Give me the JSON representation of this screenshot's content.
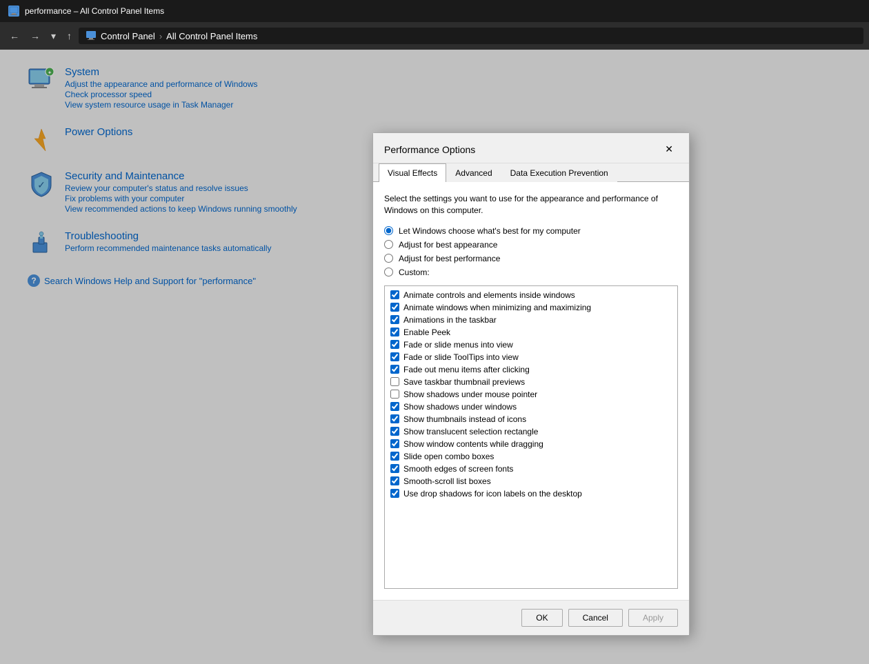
{
  "titleBar": {
    "title": "performance – All Control Panel Items",
    "icon": "monitor-icon"
  },
  "addressBar": {
    "backLabel": "←",
    "forwardLabel": "→",
    "downLabel": "▾",
    "upLabel": "↑",
    "path": [
      "Control Panel",
      "All Control Panel Items"
    ],
    "iconAlt": "control-panel-icon"
  },
  "controlPanel": {
    "items": [
      {
        "id": "system",
        "title": "System",
        "links": [
          "Adjust the appearance and performance of Windows",
          "Check processor speed",
          "View system resource usage in Task Manager"
        ]
      },
      {
        "id": "power",
        "title": "Power Options",
        "links": []
      },
      {
        "id": "security",
        "title": "Security and Maintenance",
        "links": [
          "Review your computer's status and resolve issues",
          "Fix problems with your computer",
          "View recommended actions to keep Windows running smoothly"
        ]
      },
      {
        "id": "troubleshoot",
        "title": "Troubleshooting",
        "links": [
          "Perform recommended maintenance tasks automatically"
        ]
      }
    ],
    "searchLink": "Search Windows Help and Support for \"performance\""
  },
  "dialog": {
    "title": "Performance Options",
    "closeLabel": "✕",
    "tabs": [
      {
        "id": "visual",
        "label": "Visual Effects",
        "active": true
      },
      {
        "id": "advanced",
        "label": "Advanced",
        "active": false
      },
      {
        "id": "dep",
        "label": "Data Execution Prevention",
        "active": false
      }
    ],
    "description": "Select the settings you want to use for the appearance and performance of Windows on this computer.",
    "radioOptions": [
      {
        "id": "r1",
        "label": "Let Windows choose what's best for my computer",
        "checked": true
      },
      {
        "id": "r2",
        "label": "Adjust for best appearance",
        "checked": false
      },
      {
        "id": "r3",
        "label": "Adjust for best performance",
        "checked": false
      },
      {
        "id": "r4",
        "label": "Custom:",
        "checked": false
      }
    ],
    "checkboxItems": [
      {
        "label": "Animate controls and elements inside windows",
        "checked": true
      },
      {
        "label": "Animate windows when minimizing and maximizing",
        "checked": true
      },
      {
        "label": "Animations in the taskbar",
        "checked": true
      },
      {
        "label": "Enable Peek",
        "checked": true
      },
      {
        "label": "Fade or slide menus into view",
        "checked": true
      },
      {
        "label": "Fade or slide ToolTips into view",
        "checked": true
      },
      {
        "label": "Fade out menu items after clicking",
        "checked": true
      },
      {
        "label": "Save taskbar thumbnail previews",
        "checked": false
      },
      {
        "label": "Show shadows under mouse pointer",
        "checked": false
      },
      {
        "label": "Show shadows under windows",
        "checked": true
      },
      {
        "label": "Show thumbnails instead of icons",
        "checked": true
      },
      {
        "label": "Show translucent selection rectangle",
        "checked": true
      },
      {
        "label": "Show window contents while dragging",
        "checked": true
      },
      {
        "label": "Slide open combo boxes",
        "checked": true
      },
      {
        "label": "Smooth edges of screen fonts",
        "checked": true
      },
      {
        "label": "Smooth-scroll list boxes",
        "checked": true
      },
      {
        "label": "Use drop shadows for icon labels on the desktop",
        "checked": true
      }
    ],
    "buttons": {
      "ok": "OK",
      "cancel": "Cancel",
      "apply": "Apply",
      "applyDisabled": true
    }
  }
}
